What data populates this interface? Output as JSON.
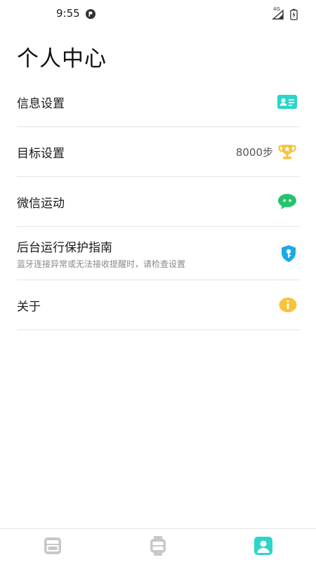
{
  "status": {
    "time": "9:55",
    "network": "4G"
  },
  "page_title": "个人中心",
  "menu": [
    {
      "label": "信息设置",
      "icon": "id-card-icon",
      "color": "#2ad6c9"
    },
    {
      "label": "目标设置",
      "value": "8000步",
      "icon": "trophy-icon",
      "color": "#f7c33c"
    },
    {
      "label": "微信运动",
      "icon": "wechat-icon",
      "color": "#25c36b"
    },
    {
      "label": "后台运行保护指南",
      "sub": "蓝牙连接异常或无法接收提醒时，请检查设置",
      "icon": "shield-key-icon",
      "color": "#1aa8e8"
    },
    {
      "label": "关于",
      "icon": "info-icon",
      "color": "#f7c33c"
    }
  ],
  "bottom_nav": [
    {
      "icon": "panel-icon",
      "active": false
    },
    {
      "icon": "watch-icon",
      "active": false
    },
    {
      "icon": "profile-icon",
      "active": true
    }
  ],
  "colors": {
    "accent": "#2ad6c9",
    "inactive_icon": "#c8c8c8"
  }
}
